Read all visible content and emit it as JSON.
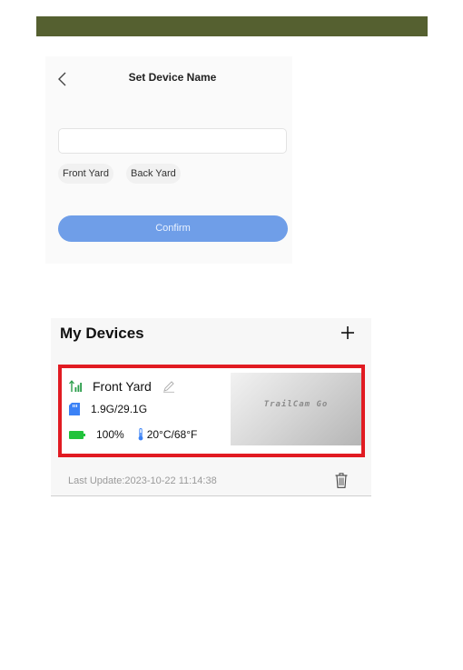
{
  "set_device_name": {
    "title": "Set Device Name",
    "input_value": "",
    "input_placeholder": "",
    "suggestions": [
      "Front Yard",
      "Back Yard"
    ],
    "confirm_label": "Confirm"
  },
  "my_devices": {
    "title": "My Devices",
    "device": {
      "name": "Front Yard",
      "storage": "1.9G/29.1G",
      "battery": "100%",
      "temperature": "20°C/68°F",
      "thumbnail_text": "TrailCam Go",
      "last_update": "Last Update:2023-10-22 11:14:38"
    }
  },
  "icons": {
    "back": "chevron-left-icon",
    "add": "plus-icon",
    "signal": "signal-icon",
    "edit": "pencil-icon",
    "storage": "sd-card-icon",
    "battery": "battery-icon",
    "temperature": "thermometer-icon",
    "delete": "trash-icon"
  },
  "colors": {
    "top_bar": "#556030",
    "confirm_button": "#6f9ee8",
    "highlight_border": "#e11b22",
    "battery_green": "#22c33c",
    "signal_green": "#2a9d4a"
  }
}
